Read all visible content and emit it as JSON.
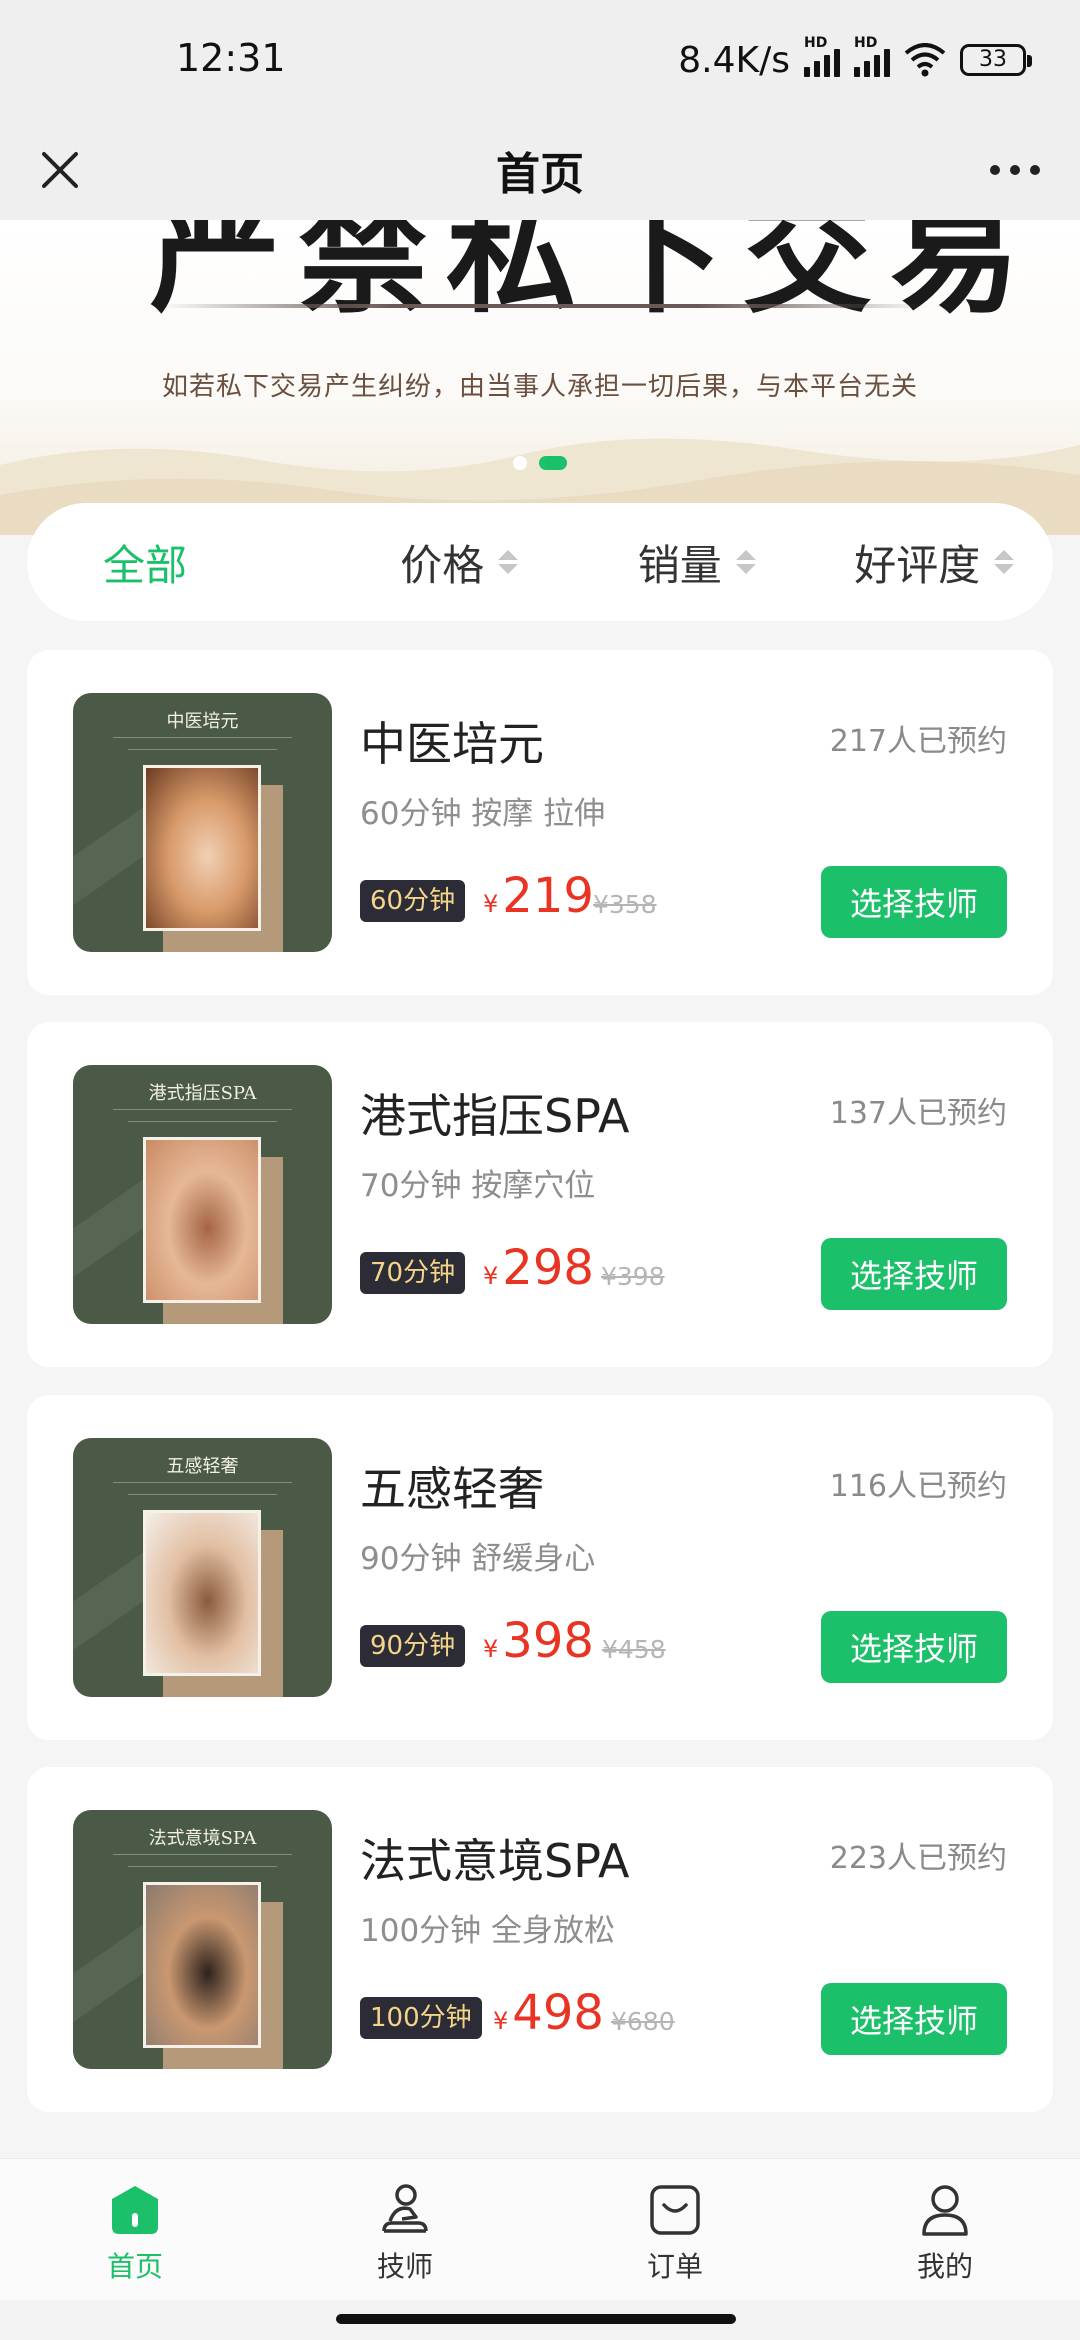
{
  "status_bar": {
    "time": "12:31",
    "network_speed": "8.4K/s",
    "hd_label": "HD",
    "battery": "33"
  },
  "nav": {
    "title": "首页",
    "close_icon": "close-icon",
    "more_icon": "more-icon"
  },
  "banner": {
    "big_text": "严禁私下交易",
    "subtitle": "如若私下交易产生纠纷，由当事人承担一切后果，与本平台无关",
    "pages": 2,
    "active_page": 2
  },
  "filters": [
    {
      "label": "全部",
      "active": true
    },
    {
      "label": "价格",
      "active": false
    },
    {
      "label": "销量",
      "active": false
    },
    {
      "label": "好评度",
      "active": false
    }
  ],
  "services": [
    {
      "name": "中医培元",
      "booked": "217人已预约",
      "desc": "60分钟 按摩 拉伸",
      "tag": "60分钟",
      "currency": "¥",
      "price": "219",
      "orig_price": "¥358",
      "button": "选择技师",
      "thumb_title": "中医培元",
      "photo_colors": [
        "#6b3b22",
        "#d89a6a",
        "#f1d0b4"
      ]
    },
    {
      "name": "港式指压SPA",
      "booked": "137人已预约",
      "desc": "70分钟 按摩穴位",
      "tag": "70分钟",
      "currency": "¥",
      "price": "298",
      "orig_price": "¥398",
      "button": "选择技师",
      "thumb_title": "港式指压SPA",
      "photo_colors": [
        "#c98a63",
        "#e6b897",
        "#a56545"
      ]
    },
    {
      "name": "五感轻奢",
      "booked": "116人已预约",
      "desc": "90分钟 舒缓身心",
      "tag": "90分钟",
      "currency": "¥",
      "price": "398",
      "orig_price": "¥458",
      "button": "选择技师",
      "thumb_title": "五感轻奢",
      "photo_colors": [
        "#f4efe8",
        "#e2bfa3",
        "#8a5a3c"
      ]
    },
    {
      "name": "法式意境SPA",
      "booked": "223人已预约",
      "desc": "100分钟 全身放松",
      "tag": "100分钟",
      "currency": "¥",
      "price": "498",
      "orig_price": "¥680",
      "button": "选择技师",
      "thumb_title": "法式意境SPA",
      "photo_colors": [
        "#8a7a6e",
        "#c99871",
        "#2e221c"
      ]
    }
  ],
  "tabs": [
    {
      "label": "首页",
      "icon": "home-icon",
      "active": true
    },
    {
      "label": "技师",
      "icon": "therapist-icon",
      "active": false
    },
    {
      "label": "订单",
      "icon": "order-icon",
      "active": false
    },
    {
      "label": "我的",
      "icon": "profile-icon",
      "active": false
    }
  ],
  "colors": {
    "accent": "#1dc06a",
    "price": "#e93323",
    "tag_bg": "#2c2c36",
    "tag_text": "#f3d48a",
    "thumb_bg": "#4b5a46"
  }
}
